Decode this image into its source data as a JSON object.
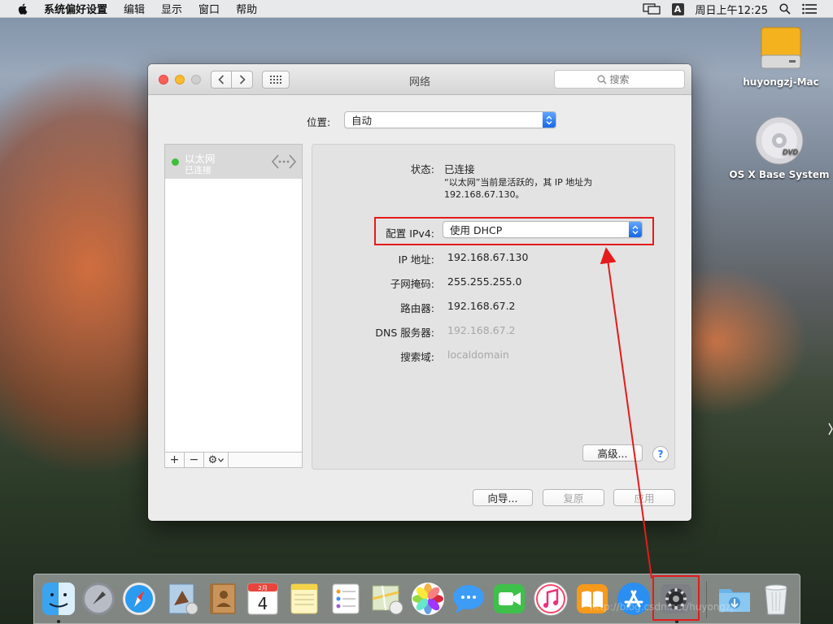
{
  "menubar": {
    "app_name": "系统偏好设置",
    "menus": [
      "编辑",
      "显示",
      "窗口",
      "帮助"
    ],
    "input_source": "A",
    "clock": "周日上午12:25"
  },
  "desktop": {
    "hd_label": "huyongzj-Mac",
    "dvd_label": "OS X Base System",
    "dvd_badge": "DVD"
  },
  "window": {
    "title": "网络",
    "search_placeholder": "搜索",
    "location_label": "位置:",
    "location_value": "自动",
    "service": {
      "name": "以太网",
      "status": "已连接",
      "status_color": "#3dbf3a"
    },
    "list_toolbar": {
      "add": "+",
      "remove": "−",
      "gear": "⚙"
    },
    "detail": {
      "status_label": "状态:",
      "status_value": "已连接",
      "status_desc_line1": "“以太网”当前是活跃的，其 IP 地址为",
      "status_desc_line2": "192.168.67.130。",
      "ipv4_label": "配置 IPv4:",
      "ipv4_value": "使用 DHCP",
      "ip_label": "IP 地址:",
      "ip_value": "192.168.67.130",
      "subnet_label": "子网掩码:",
      "subnet_value": "255.255.255.0",
      "router_label": "路由器:",
      "router_value": "192.168.67.2",
      "dns_label": "DNS 服务器:",
      "dns_value": "192.168.67.2",
      "search_domain_label": "搜索域:",
      "search_domain_value": "localdomain",
      "advanced_label": "高级...",
      "help_label": "?"
    },
    "buttons": {
      "assistant": "向导...",
      "revert": "复原",
      "apply": "应用"
    }
  },
  "dock": {
    "calendar_month": "2月",
    "calendar_day": "4"
  },
  "annotation_color": "#e41b1b",
  "watermark": "http://blog.csdn.net/huyongzj"
}
